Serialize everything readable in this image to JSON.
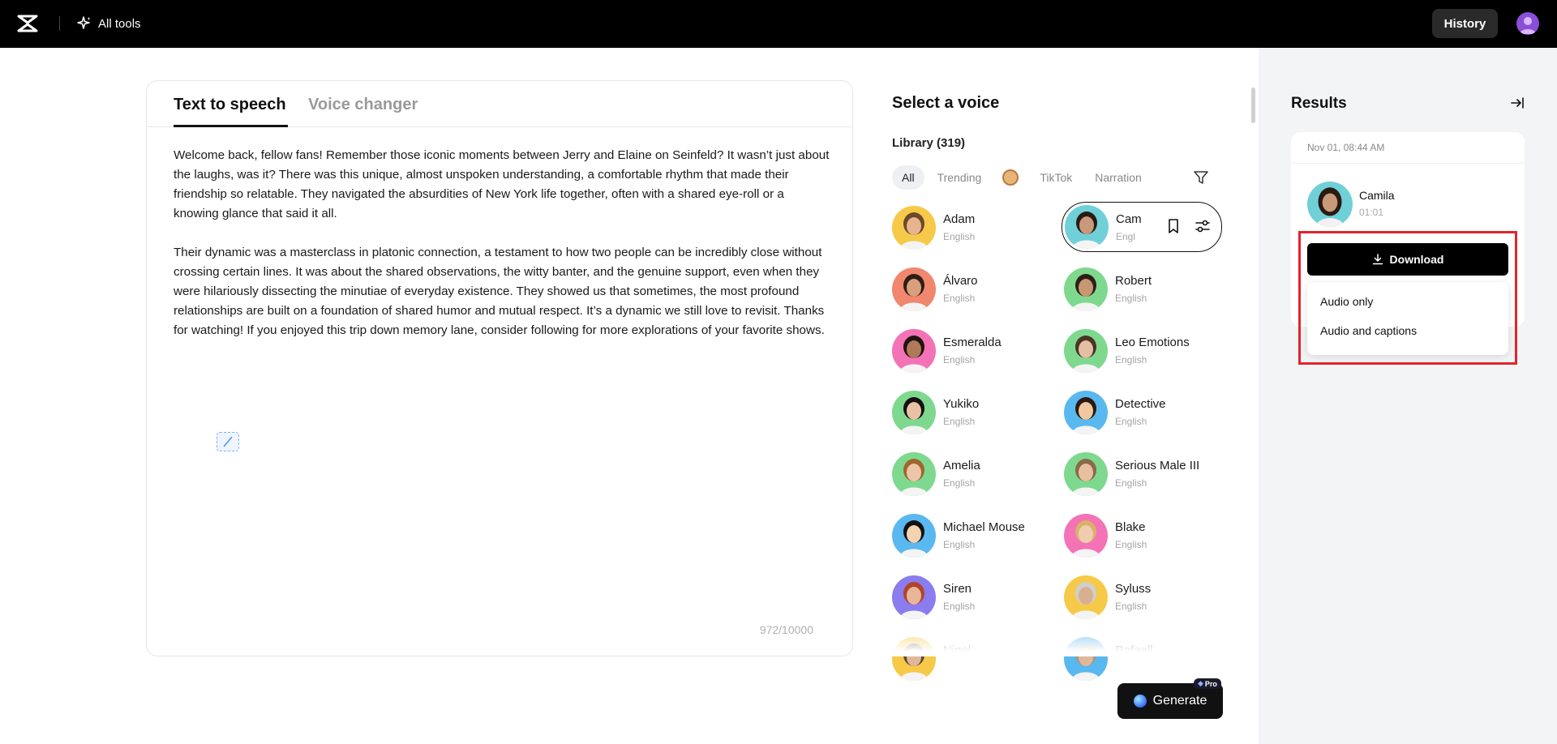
{
  "header": {
    "all_tools_label": "All tools",
    "history_label": "History"
  },
  "editor": {
    "tabs": [
      {
        "label": "Text to speech",
        "active": true
      },
      {
        "label": "Voice changer",
        "active": false
      }
    ],
    "paragraphs": [
      "Welcome back, fellow fans! Remember those iconic moments between Jerry and Elaine on Seinfeld? It wasn’t just about the laughs, was it? There was this unique, almost unspoken understanding, a comfortable rhythm that made their friendship so relatable. They navigated the absurdities of New York life together, often with a shared eye-roll or a knowing glance that said it all.",
      "Their dynamic was a masterclass in platonic connection, a testament to how two people can be incredibly close without crossing certain lines. It was about the shared observations, the witty banter, and the genuine support, even when they were hilariously dissecting the minutiae of everyday existence. They showed us that sometimes, the most profound relationships are built on a foundation of shared humor and mutual respect. It’s a dynamic we still love to revisit. Thanks for watching! If you enjoyed this trip down memory lane, consider following for more explorations of your favorite shows."
    ],
    "char_count": "972/10000"
  },
  "voices": {
    "title": "Select a voice",
    "library_label": "Library (319)",
    "filters": [
      "All",
      "Trending",
      "TikTok",
      "Narration"
    ],
    "list": [
      {
        "name": "Adam",
        "lang": "English",
        "bg": "#f7c948",
        "skin": "#e8b48f",
        "hair": "#6b4a2b"
      },
      {
        "name": "Cam",
        "lang": "Engl",
        "bg": "#6fd0d8",
        "skin": "#c99a7a",
        "hair": "#2a1a12"
      },
      {
        "name": "Álvaro",
        "lang": "English",
        "bg": "#f0876e",
        "skin": "#d9a07e",
        "hair": "#2e1d14"
      },
      {
        "name": "Robert",
        "lang": "English",
        "bg": "#7ed98f",
        "skin": "#c99673",
        "hair": "#2b2016"
      },
      {
        "name": "Esmeralda",
        "lang": "English",
        "bg": "#f472b6",
        "skin": "#b07a5a",
        "hair": "#1f140e"
      },
      {
        "name": "Leo Emotions",
        "lang": "English",
        "bg": "#7ed98f",
        "skin": "#e4bfa3",
        "hair": "#4a3322"
      },
      {
        "name": "Yukiko",
        "lang": "English",
        "bg": "#7ed98f",
        "skin": "#e9c2a4",
        "hair": "#151010"
      },
      {
        "name": "Detective",
        "lang": "English",
        "bg": "#5ab8f0",
        "skin": "#f0c8a0",
        "hair": "#2a1a10"
      },
      {
        "name": "Amelia",
        "lang": "English",
        "bg": "#7ed98f",
        "skin": "#edc6a8",
        "hair": "#a0652f"
      },
      {
        "name": "Serious Male III",
        "lang": "English",
        "bg": "#7ed98f",
        "skin": "#e8c0a0",
        "hair": "#8a6a48"
      },
      {
        "name": "Michael Mouse",
        "lang": "English",
        "bg": "#5ab8f0",
        "skin": "#f3d3b0",
        "hair": "#111111"
      },
      {
        "name": "Blake",
        "lang": "English",
        "bg": "#f472b6",
        "skin": "#f0cdb0",
        "hair": "#d9b26a"
      },
      {
        "name": "Siren",
        "lang": "English",
        "bg": "#8b7cf0",
        "skin": "#e8b698",
        "hair": "#b0452a"
      },
      {
        "name": "Syluss",
        "lang": "English",
        "bg": "#f7c948",
        "skin": "#d8b090",
        "hair": "#cfcfcf"
      },
      {
        "name": "Nigel",
        "lang": "",
        "bg": "#f7c948",
        "skin": "#e0b898",
        "hair": "#5a4a3a"
      },
      {
        "name": "Rafaell",
        "lang": "",
        "bg": "#5ab8f0",
        "skin": "#e0b898",
        "hair": "#9a9a9a"
      }
    ]
  },
  "generate": {
    "label": "Generate",
    "badge": "Pro"
  },
  "results": {
    "title": "Results",
    "date": "Nov 01, 08:44 AM",
    "voice_name": "Camila",
    "duration": "01:01",
    "download_label": "Download",
    "menu": [
      "Audio only",
      "Audio and captions"
    ]
  },
  "colors": {
    "highlight": "#e3242b",
    "primary": "#000000",
    "panel_bg": "#f3f4f6"
  }
}
